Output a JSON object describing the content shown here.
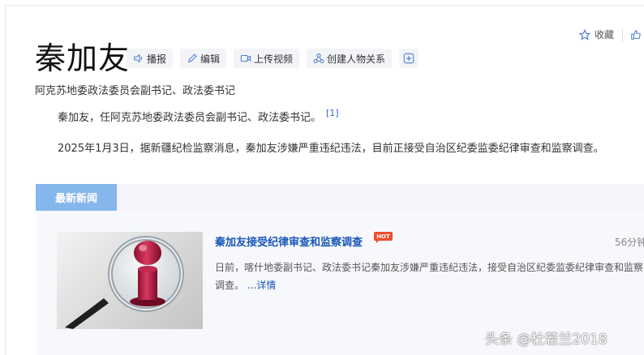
{
  "header": {
    "title": "秦加友",
    "subtitle": "阿克苏地委政法委员会副书记、政法委书记",
    "favorite_label": "收藏",
    "toolbar": [
      {
        "label": "播报",
        "icon": "speaker-icon"
      },
      {
        "label": "编辑",
        "icon": "pencil-icon"
      },
      {
        "label": "上传视频",
        "icon": "video-icon"
      },
      {
        "label": "创建人物关系",
        "icon": "relation-icon"
      },
      {
        "label": "",
        "icon": "plus-icon"
      }
    ]
  },
  "content": {
    "para1": "秦加友，任阿克苏地委政法委员会副书记、政法委书记。",
    "para1_ref": "[1]",
    "para2": "2025年1月3日，据新疆纪检监察消息，秦加友涉嫌严重违纪违法，目前正接受自治区纪委监委纪律审查和监察调查。"
  },
  "news": {
    "tab_label": "最新新闻",
    "item": {
      "title": "秦加友接受纪律审查和监察调查",
      "badge": "HOT",
      "time": "56分钟",
      "summary": "日前，喀什地委副书记、政法委书记秦加友涉嫌严重违纪违法，接受自治区纪委监委纪律审查和监察调查。",
      "more_label": "...详情"
    }
  },
  "watermark": "头条 @杜若兰2018",
  "colors": {
    "accent_blue": "#1a56b8",
    "news_tab": "#86b7ec",
    "hot": "#ee4d2d"
  }
}
